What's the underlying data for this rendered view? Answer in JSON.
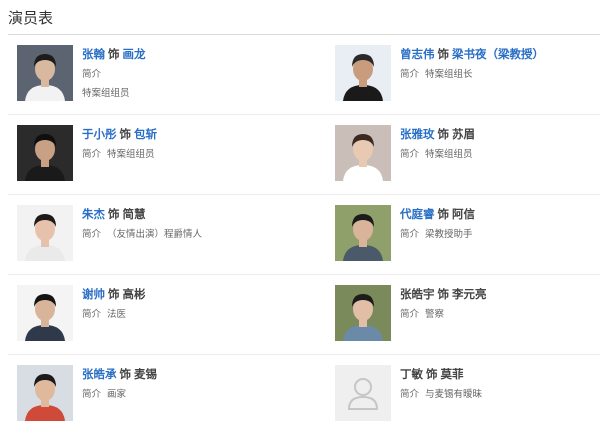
{
  "section": {
    "title": "演员表"
  },
  "cast": [
    {
      "actor": "张翰",
      "connector": "饰",
      "role": "画龙",
      "actor_link": true,
      "role_link": true,
      "intro_label": "简介",
      "intro_text": "",
      "desc": "特案组组员",
      "photo": {
        "icon": "actor-photo",
        "bg": "#5b6470",
        "face": "#d9b8a0",
        "hair": "#1c1c1c",
        "shirt": "#f2f2f2"
      }
    },
    {
      "actor": "曾志伟",
      "connector": "饰",
      "role": "梁书夜（梁教授）",
      "actor_link": true,
      "role_link": true,
      "intro_label": "简介",
      "intro_text": "特案组组长",
      "desc": "",
      "photo": {
        "icon": "actor-photo",
        "bg": "#e8eef4",
        "face": "#c99c7e",
        "hair": "#2a2a2a",
        "shirt": "#1a1a1a"
      }
    },
    {
      "actor": "于小彤",
      "connector": "饰",
      "role": "包斩",
      "actor_link": true,
      "role_link": true,
      "intro_label": "简介",
      "intro_text": "特案组组员",
      "desc": "",
      "photo": {
        "icon": "actor-photo",
        "bg": "#2b2b2b",
        "face": "#c8a185",
        "hair": "#0f0f0f",
        "shirt": "#1a1a1a"
      }
    },
    {
      "actor": "张雅玫",
      "connector": "饰",
      "role": "苏眉",
      "actor_link": true,
      "role_link": false,
      "intro_label": "简介",
      "intro_text": "特案组组员",
      "desc": "",
      "photo": {
        "icon": "actor-photo",
        "bg": "#c9bfb8",
        "face": "#e8c9b2",
        "hair": "#3a2a22",
        "shirt": "#ffffff"
      }
    },
    {
      "actor": "朱杰",
      "connector": "饰",
      "role": "简慧",
      "actor_link": true,
      "role_link": false,
      "intro_label": "简介",
      "intro_text": "（友情出演）程爵情人",
      "desc": "",
      "photo": {
        "icon": "actor-photo",
        "bg": "#f2f2f2",
        "face": "#e6c2ad",
        "hair": "#1e1a18",
        "shirt": "#eaeaea"
      }
    },
    {
      "actor": "代庭睿",
      "connector": "饰",
      "role": "阿信",
      "actor_link": true,
      "role_link": false,
      "intro_label": "简介",
      "intro_text": "梁教授助手",
      "desc": "",
      "photo": {
        "icon": "actor-photo",
        "bg": "#8fa06a",
        "face": "#d9b39a",
        "hair": "#1b1b1b",
        "shirt": "#4a5a6a"
      }
    },
    {
      "actor": "谢帅",
      "connector": "饰",
      "role": "高彬",
      "actor_link": true,
      "role_link": false,
      "intro_label": "简介",
      "intro_text": "法医",
      "desc": "",
      "photo": {
        "icon": "actor-photo",
        "bg": "#f4f4f4",
        "face": "#d8b49a",
        "hair": "#141414",
        "shirt": "#2e3a4a"
      }
    },
    {
      "actor": "张皓宇",
      "connector": "饰",
      "role": "李元亮",
      "actor_link": false,
      "role_link": false,
      "intro_label": "简介",
      "intro_text": "警察",
      "desc": "",
      "photo": {
        "icon": "actor-photo",
        "bg": "#7a8a5a",
        "face": "#e2bea6",
        "hair": "#1c1c1c",
        "shirt": "#6a8aa8"
      }
    },
    {
      "actor": "张皓承",
      "connector": "饰",
      "role": "麦锡",
      "actor_link": true,
      "role_link": false,
      "intro_label": "简介",
      "intro_text": "画家",
      "desc": "",
      "photo": {
        "icon": "actor-photo",
        "bg": "#d7dde3",
        "face": "#e0b89c",
        "hair": "#1a1a1a",
        "shirt": "#d04a3a"
      }
    },
    {
      "actor": "丁敏",
      "connector": "饰",
      "role": "莫菲",
      "actor_link": false,
      "role_link": false,
      "intro_label": "简介",
      "intro_text": "与麦锡有暧昧",
      "desc": "",
      "photo": {
        "icon": "person-placeholder-icon",
        "bg": "#efefef",
        "face": "#cfcfcf",
        "hair": "#cfcfcf",
        "shirt": "#cfcfcf"
      }
    }
  ]
}
